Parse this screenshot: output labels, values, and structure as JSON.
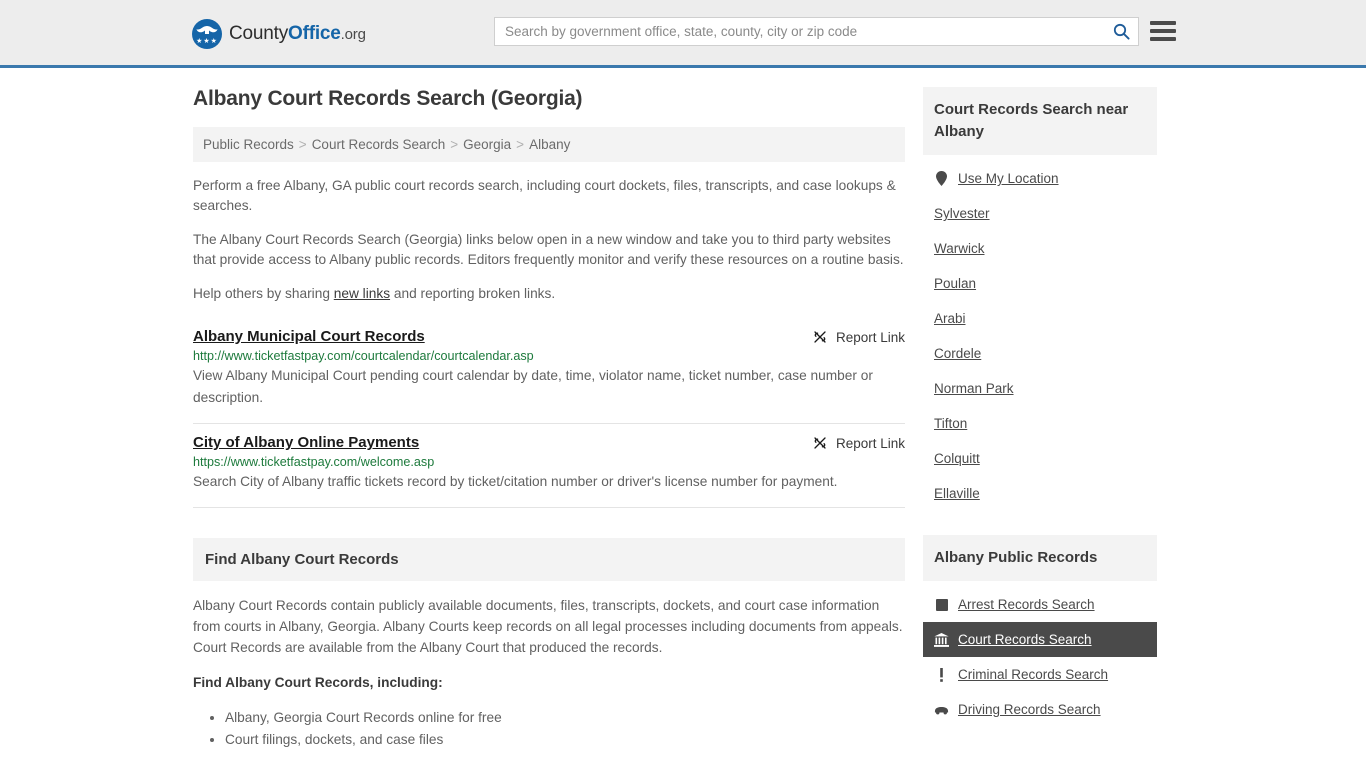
{
  "header": {
    "logo": {
      "part1": "County",
      "part2": "Office",
      "part3": ".org",
      "stars": "★★★"
    },
    "search": {
      "placeholder": "Search by government office, state, county, city or zip code",
      "value": "",
      "icon": "search-icon"
    },
    "menu_icon": "hamburger-menu-icon",
    "accent_color": "#3b79ad",
    "background_color": "#ededed"
  },
  "main": {
    "title": "Albany Court Records Search (Georgia)",
    "breadcrumb": [
      {
        "label": "Public Records"
      },
      {
        "label": "Court Records Search"
      },
      {
        "label": "Georgia"
      },
      {
        "label": "Albany"
      }
    ],
    "breadcrumb_separator": ">",
    "intro": [
      "Perform a free Albany, GA public court records search, including court dockets, files, transcripts, and case lookups & searches.",
      "The Albany Court Records Search (Georgia) links below open in a new window and take you to third party websites that provide access to Albany public records. Editors frequently monitor and verify these resources on a routine basis."
    ],
    "help_line": {
      "before": "Help others by sharing ",
      "link": "new links",
      "after": " and reporting broken links."
    },
    "report_label": "Report Link",
    "report_icon": "broken-link-icon",
    "listings": [
      {
        "title": "Albany Municipal Court Records",
        "url": "http://www.ticketfastpay.com/courtcalendar/courtcalendar.asp",
        "description": "View Albany Municipal Court pending court calendar by date, time, violator name, ticket number, case number or description."
      },
      {
        "title": "City of Albany Online Payments",
        "url": "https://www.ticketfastpay.com/welcome.asp",
        "description": "Search City of Albany traffic tickets record by ticket/citation number or driver's license number for payment."
      }
    ],
    "find_section": {
      "heading": "Find Albany Court Records",
      "paragraph": "Albany Court Records contain publicly available documents, files, transcripts, dockets, and court case information from courts in Albany, Georgia. Albany Courts keep records on all legal processes including documents from appeals. Court Records are available from the Albany Court that produced the records.",
      "subheading": "Find Albany Court Records, including:",
      "items": [
        "Albany, Georgia Court Records online for free",
        "Court filings, dockets, and case files"
      ]
    }
  },
  "sidebar": {
    "nearby": {
      "heading": "Court Records Search near Albany",
      "use_my_location": {
        "label": "Use My Location",
        "icon": "map-pin-icon"
      },
      "cities": [
        "Sylvester",
        "Warwick",
        "Poulan",
        "Arabi",
        "Cordele",
        "Norman Park",
        "Tifton",
        "Colquitt",
        "Ellaville"
      ]
    },
    "public_records": {
      "heading": "Albany Public Records",
      "items": [
        {
          "label": "Arrest Records Search",
          "icon": "fingerprint-icon",
          "active": false
        },
        {
          "label": "Court Records Search",
          "icon": "courthouse-icon",
          "active": true
        },
        {
          "label": "Criminal Records Search",
          "icon": "exclamation-icon",
          "active": false
        },
        {
          "label": "Driving Records Search",
          "icon": "car-icon",
          "active": false
        }
      ],
      "active_background": "#4a4a4a"
    }
  }
}
